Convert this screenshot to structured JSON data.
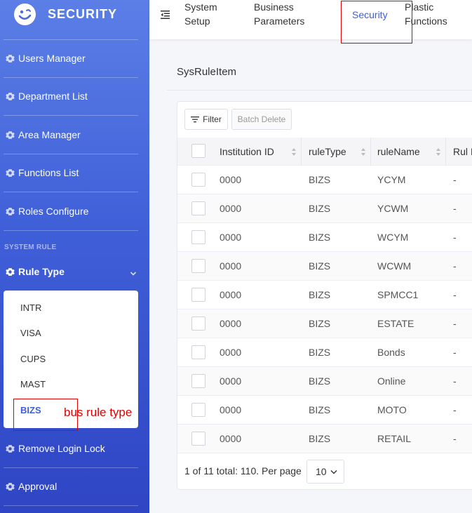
{
  "app": {
    "title": "SECURITY"
  },
  "sidebar": {
    "items": [
      {
        "label": "Users Manager",
        "icon": "gear-icon"
      },
      {
        "label": "Department List",
        "icon": "gear-icon"
      },
      {
        "label": "Area Manager",
        "icon": "gear-icon"
      },
      {
        "label": "Functions List",
        "icon": "gear-icon"
      },
      {
        "label": "Roles Configure",
        "icon": "gear-icon"
      }
    ],
    "section_label": "SYSTEM RULE",
    "rule_type": {
      "label": "Rule Type",
      "icon": "gear-icon",
      "expanded": true
    },
    "rule_type_options": [
      "INTR",
      "VISA",
      "CUPS",
      "MAST",
      "BIZS"
    ],
    "selected_option": "BIZS",
    "bottom_items": [
      {
        "label": "Remove Login Lock",
        "icon": "gear-icon"
      },
      {
        "label": "Approval",
        "icon": "gear-icon"
      }
    ]
  },
  "topnav": {
    "tabs": [
      {
        "line1": "System",
        "line2": "Setup"
      },
      {
        "line1": "Business",
        "line2": "Parameters"
      },
      {
        "line1": "Security",
        "line2": ""
      },
      {
        "line1": "Plastic",
        "line2": "Functions"
      }
    ],
    "active_tab": "Security"
  },
  "page": {
    "title": "SysRuleItem",
    "filter_label": "Filter",
    "batch_delete_label": "Batch Delete"
  },
  "table": {
    "columns": [
      "Institution ID",
      "ruleType",
      "ruleName",
      "Rul I"
    ],
    "rows": [
      [
        "0000",
        "BIZS",
        "YCYM",
        "-"
      ],
      [
        "0000",
        "BIZS",
        "YCWM",
        "-"
      ],
      [
        "0000",
        "BIZS",
        "WCYM",
        "-"
      ],
      [
        "0000",
        "BIZS",
        "WCWM",
        "-"
      ],
      [
        "0000",
        "BIZS",
        "SPMCC1",
        "-"
      ],
      [
        "0000",
        "BIZS",
        "ESTATE",
        "-"
      ],
      [
        "0000",
        "BIZS",
        "Bonds",
        "-"
      ],
      [
        "0000",
        "BIZS",
        "Online",
        "-"
      ],
      [
        "0000",
        "BIZS",
        "MOTO",
        "-"
      ],
      [
        "0000",
        "BIZS",
        "RETAIL",
        "-"
      ]
    ]
  },
  "pagination": {
    "summary": "1 of 11 total: 110.",
    "per_page_label": "Per page",
    "per_page_value": "10"
  },
  "annotation": {
    "text": "bus rule type",
    "color": "#e00000"
  },
  "colors": {
    "accent": "#3f5fd8",
    "sidebar_top": "#5b7fe6",
    "sidebar_bottom": "#2f45c4"
  }
}
